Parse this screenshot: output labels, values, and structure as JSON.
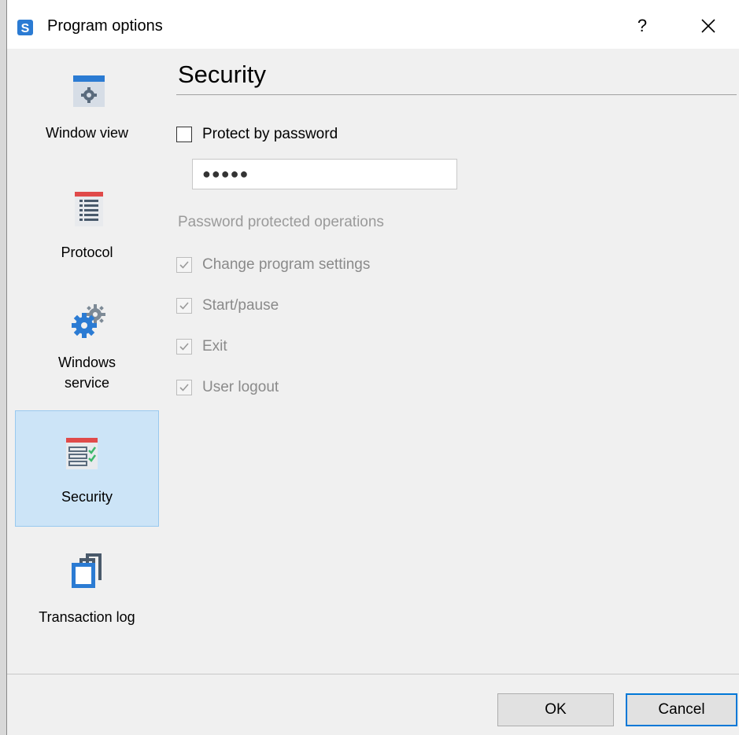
{
  "window": {
    "title": "Program options",
    "help_label": "?",
    "close_icon": "close-icon"
  },
  "sidebar": {
    "items": [
      {
        "label": "Window view",
        "icon": "window-gear-icon",
        "selected": false
      },
      {
        "label": "Protocol",
        "icon": "protocol-list-icon",
        "selected": false
      },
      {
        "label": "Windows service",
        "label_line1": "Windows",
        "label_line2": "service",
        "icon": "gears-icon",
        "selected": false
      },
      {
        "label": "Security",
        "icon": "security-checklist-icon",
        "selected": true
      },
      {
        "label": "Transaction log",
        "icon": "stacked-windows-icon",
        "selected": false
      }
    ]
  },
  "content": {
    "title": "Security",
    "protect_by_password": {
      "label": "Protect by password",
      "checked": false
    },
    "password_field": {
      "value": "●●●●●"
    },
    "group_label": "Password protected operations",
    "operations": [
      {
        "label": "Change program settings",
        "checked": true,
        "disabled": true
      },
      {
        "label": "Start/pause",
        "checked": true,
        "disabled": true
      },
      {
        "label": "Exit",
        "checked": true,
        "disabled": true
      },
      {
        "label": "User logout",
        "checked": true,
        "disabled": true
      }
    ]
  },
  "footer": {
    "ok_label": "OK",
    "cancel_label": "Cancel"
  },
  "colors": {
    "accent": "#0078d7",
    "selected_bg": "#cce4f7",
    "icon_blue": "#2b7bd3",
    "icon_red": "#e04a4a",
    "icon_green": "#3db86b"
  }
}
